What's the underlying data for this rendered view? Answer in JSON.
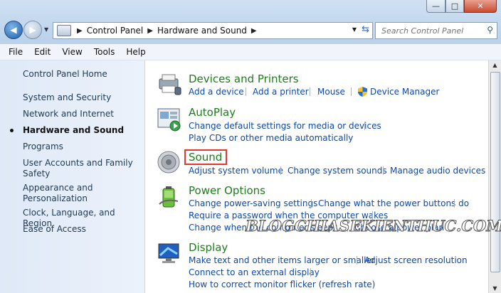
{
  "window": {
    "minimize_glyph": "—",
    "maximize_glyph": "□",
    "close_glyph": "✕"
  },
  "nav": {
    "back_glyph": "◀",
    "forward_glyph": "▶",
    "breadcrumbs": [
      "Control Panel",
      "Hardware and Sound"
    ],
    "search_placeholder": "Search Control Panel"
  },
  "menu": [
    "File",
    "Edit",
    "View",
    "Tools",
    "Help"
  ],
  "sidebar": {
    "items": [
      {
        "label": "Control Panel Home"
      },
      {
        "label": "System and Security"
      },
      {
        "label": "Network and Internet"
      },
      {
        "label": "Hardware and Sound",
        "current": true
      },
      {
        "label": "Programs"
      },
      {
        "label": "User Accounts and Family Safety"
      },
      {
        "label": "Appearance and Personalization"
      },
      {
        "label": "Clock, Language, and Region"
      },
      {
        "label": "Ease of Access"
      }
    ]
  },
  "categories": {
    "devices": {
      "title": "Devices and Printers",
      "links": [
        "Add a device",
        "Add a printer",
        "Mouse",
        "Device Manager"
      ]
    },
    "autoplay": {
      "title": "AutoPlay",
      "links": [
        "Change default settings for media or devices",
        "Play CDs or other media automatically"
      ]
    },
    "sound": {
      "title": "Sound",
      "links": [
        "Adjust system volume",
        "Change system sounds",
        "Manage audio devices"
      ]
    },
    "power": {
      "title": "Power Options",
      "links": [
        "Change power-saving settings",
        "Change what the power buttons do",
        "Require a password when the computer wakes",
        "Change when the computer sleeps",
        "Choose a power plan"
      ]
    },
    "display": {
      "title": "Display",
      "links": [
        "Make text and other items larger or smaller",
        "Adjust screen resolution",
        "Connect to an external display",
        "How to correct monitor flicker (refresh rate)"
      ]
    }
  },
  "watermark": "BLOGCHIASEKIENTHUC.COM",
  "colors": {
    "link": "#0d48a8",
    "category_title": "#1d7d1d",
    "highlight_box": "#e03a30"
  }
}
